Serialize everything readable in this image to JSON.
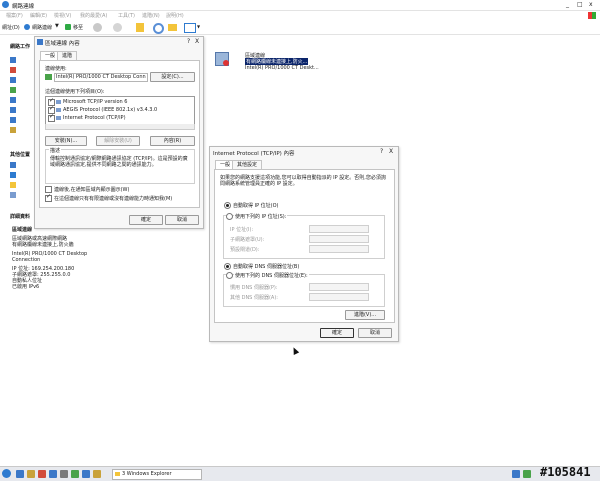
{
  "main_window": {
    "title": "網路連線",
    "menu": [
      "檔案(F)",
      "編輯(E)",
      "檢視(V)",
      "我的最愛(A)",
      "工具(T)",
      "進階(N)",
      "說明(H)"
    ],
    "address_label": "網址(D)",
    "address_value": "網路連線",
    "go_label": "移至",
    "left_panel": {
      "section1_title": "網路工作",
      "section2_title": "其他位置",
      "section3_title": "詳細資料",
      "detail_name": "區域連線",
      "detail_lines": [
        "區域網路或高速網際網路",
        "有網路纜線未連接上,防火牆",
        "Intel(R) PRO/1000 CT Desktop",
        "Connection",
        "IP 位址: 169.254.200.180",
        "子網路遮罩: 255.255.0.0",
        "自動私人位址",
        "已啟用 IPv6"
      ]
    },
    "connection_item": {
      "name": "區域連線",
      "status": "有網路纜線未連接上,防火...",
      "device": "Intel(R) PRO/1000 CT Deskt..."
    }
  },
  "props_dialog": {
    "title": "區域連線 內容",
    "tabs": [
      "一般",
      "進階"
    ],
    "connect_using_label": "連線使用:",
    "adapter_name": "Intel(R) PRO/1000 CT Desktop Conn",
    "configure_button": "設定(C)...",
    "items_label": "這個連線使用下列項目(O):",
    "items": [
      {
        "checked": true,
        "label": "Microsoft TCP/IP version 6"
      },
      {
        "checked": true,
        "label": "AEGIS Protocol (IEEE 802.1x) v3.4.3.0"
      },
      {
        "checked": true,
        "label": "Internet Protocol (TCP/IP)"
      }
    ],
    "install_button": "安裝(N)...",
    "uninstall_button": "解除安裝(U)",
    "properties_button": "內容(R)",
    "description_label": "描述",
    "description_text": "傳輸控制通訊協定/網際網路通訊協定 (TCP/IP)。這是預設的廣域網路通訊協定,提供不同網路之間的通訊能力。",
    "show_icon_label": "連線後,在通知區域內顯示圖示(W)",
    "notify_label": "在這個連線只有有限連線或沒有連線能力時通知我(M)",
    "ok_button": "確定",
    "cancel_button": "取消",
    "help_icon": "?",
    "close_icon": "X"
  },
  "tcpip_dialog": {
    "title": "Internet Protocol (TCP/IP) 內容",
    "tabs": [
      "一般",
      "其他設定"
    ],
    "intro_text": "如果您的網路支援這項功能,您可以取得自動指派的 IP 設定。否則,您必須詢問網路系統管理員正確的 IP 設定。",
    "auto_ip_label": "自動取得 IP 位址(O)",
    "use_ip_label": "使用下列的 IP 位址(S):",
    "ip_fields": [
      "IP 位址(I):",
      "子網路遮罩(U):",
      "預設閘道(D):"
    ],
    "auto_dns_label": "自動取得 DNS 伺服器位址(B)",
    "use_dns_label": "使用下列的 DNS 伺服器位址(E):",
    "dns_fields": [
      "慣用 DNS 伺服器(P):",
      "其他 DNS 伺服器(A):"
    ],
    "advanced_button": "進階(V)...",
    "ok_button": "確定",
    "cancel_button": "取消",
    "help_icon": "?",
    "close_icon": "X"
  },
  "taskbar": {
    "task_label": "3 Windows Explorer",
    "watermark": "#105841"
  }
}
